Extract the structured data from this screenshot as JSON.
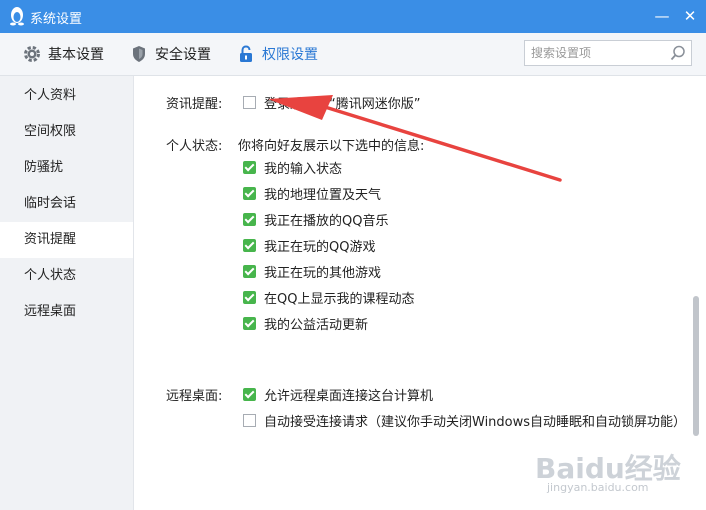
{
  "window": {
    "title": "系统设置",
    "minimize_glyph": "—",
    "close_glyph": "✕"
  },
  "nav": {
    "tabs": [
      {
        "label": "基本设置",
        "icon": "gear-icon"
      },
      {
        "label": "安全设置",
        "icon": "shield-icon"
      },
      {
        "label": "权限设置",
        "icon": "lock-icon",
        "active": true
      }
    ],
    "search": {
      "placeholder": "搜索设置项",
      "value": "",
      "icon": "search-icon"
    }
  },
  "sidebar": {
    "items": [
      {
        "label": "个人资料"
      },
      {
        "label": "空间权限"
      },
      {
        "label": "防骚扰"
      },
      {
        "label": "临时会话"
      },
      {
        "label": "资讯提醒",
        "active": true
      },
      {
        "label": "个人状态"
      },
      {
        "label": "远程桌面"
      }
    ]
  },
  "main": {
    "news": {
      "label": "资讯提醒:",
      "option": {
        "text": "登录后显示“腾讯网迷你版”",
        "checked": false
      }
    },
    "status": {
      "label": "个人状态:",
      "intro": "你将向好友展示以下选中的信息:",
      "options": [
        {
          "text": "我的输入状态",
          "checked": true
        },
        {
          "text": "我的地理位置及天气",
          "checked": true
        },
        {
          "text": "我正在播放的QQ音乐",
          "checked": true
        },
        {
          "text": "我正在玩的QQ游戏",
          "checked": true
        },
        {
          "text": "我正在玩的其他游戏",
          "checked": true
        },
        {
          "text": "在QQ上显示我的课程动态",
          "checked": true
        },
        {
          "text": "我的公益活动更新",
          "checked": true
        }
      ]
    },
    "remote": {
      "label": "远程桌面:",
      "options": [
        {
          "text": "允许远程桌面连接这台计算机",
          "checked": true
        },
        {
          "text": "自动接受连接请求（建议你手动关闭Windows自动睡眠和自动锁屏功能）",
          "checked": false
        }
      ]
    }
  },
  "watermark": {
    "brand": "Baidu经验",
    "url": "jingyan.baidu.com"
  },
  "colors": {
    "titlebar": "#3a8ee6",
    "accent": "#2a78d4",
    "check": "#47b54c",
    "annotation": "#e8433f"
  }
}
